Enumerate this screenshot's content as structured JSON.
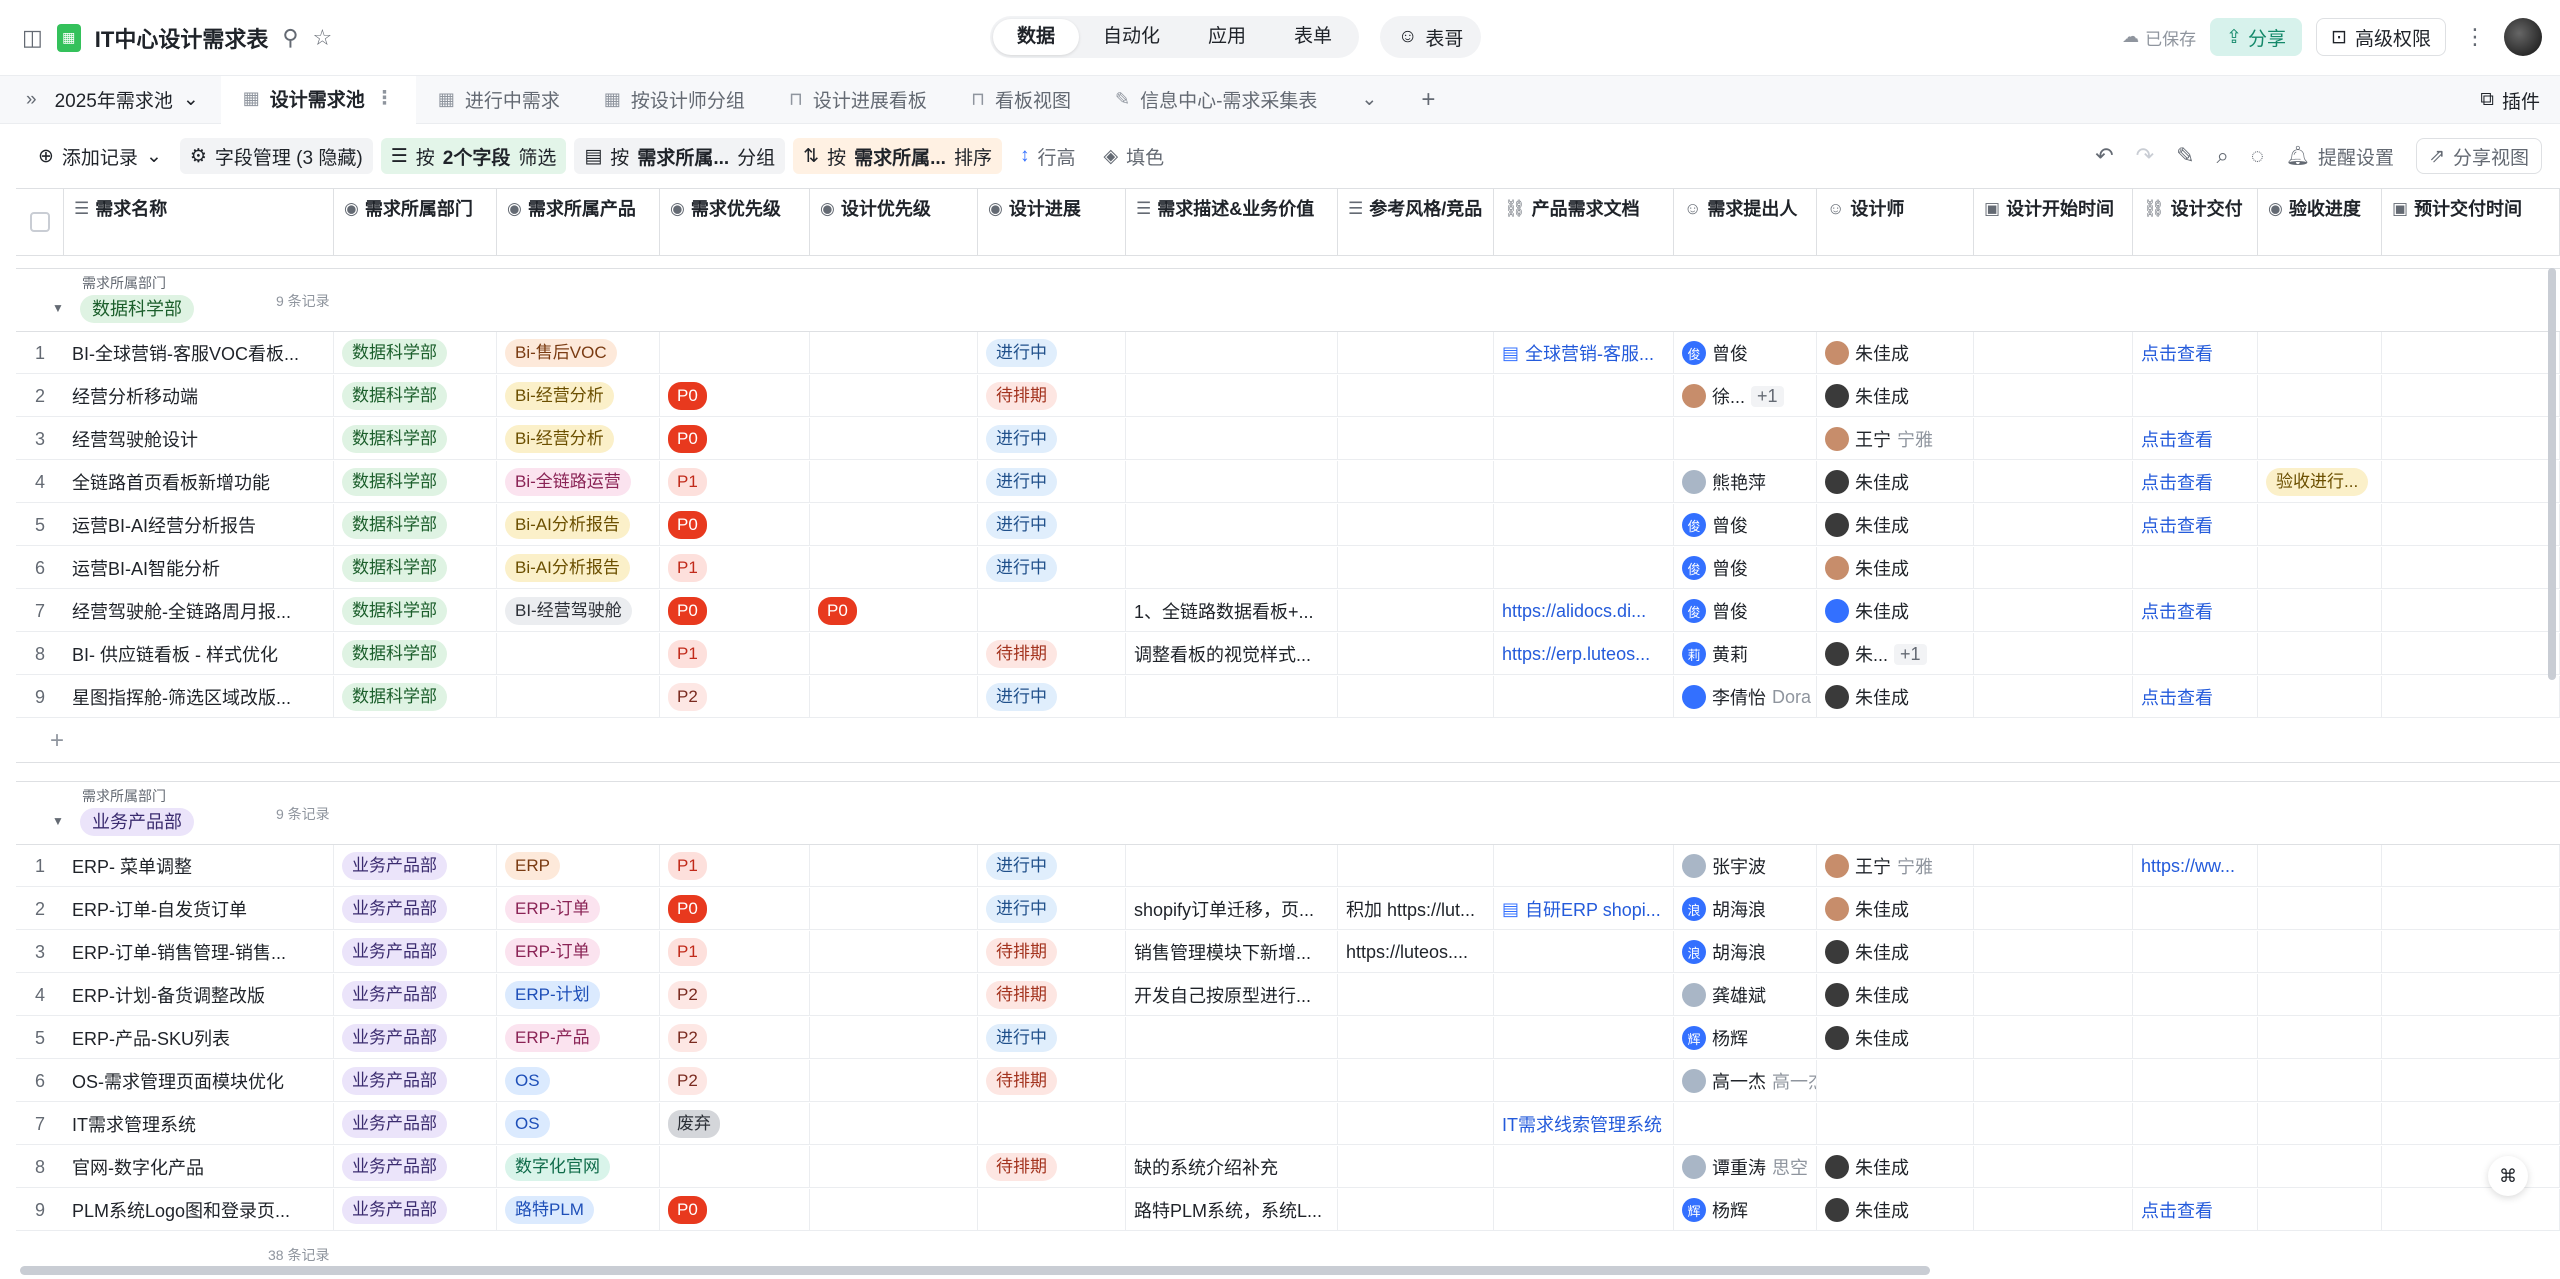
{
  "app": {
    "title": "IT中心设计需求表",
    "saved": "已保存",
    "share": "分享",
    "advanced": "高级权限"
  },
  "modes": [
    "数据",
    "自动化",
    "应用",
    "表单"
  ],
  "assistant": "表哥",
  "tabs": {
    "pool": "2025年需求池",
    "views": [
      "设计需求池",
      "进行中需求",
      "按设计师分组",
      "设计进展看板",
      "看板视图",
      "信息中心-需求采集表"
    ],
    "plugin": "插件"
  },
  "toolbar": {
    "add": "添加记录",
    "fields": "字段管理 (3 隐藏)",
    "filter_pre": "按",
    "filter_b": "2个字段",
    "filter_post": "筛选",
    "group_pre": "按",
    "group_b": "需求所属...",
    "group_post": "分组",
    "sort_pre": "按",
    "sort_b": "需求所属...",
    "sort_post": "排序",
    "rowheight": "行高",
    "fill": "填色",
    "remind": "提醒设置",
    "share_view": "分享视图"
  },
  "columns": [
    "需求名称",
    "需求所属部门",
    "需求所属产品",
    "需求优先级",
    "设计优先级",
    "设计进展",
    "需求描述&业务价值",
    "参考风格/竞品",
    "产品需求文档",
    "需求提出人",
    "设计师",
    "设计开始时间",
    "设计交付",
    "验收进度",
    "预计交付时间"
  ],
  "groups": [
    {
      "label": "需求所属部门",
      "name": "数据科学部",
      "count": "9 条记录",
      "rows": [
        {
          "n": "1",
          "name": "BI-全球营销-客服VOC看板...",
          "dept": "数据科学部",
          "prod": "Bi-售后VOC",
          "prod_c": "t-orange",
          "prio": "",
          "dprio": "",
          "prog": "进行中",
          "desc": "",
          "ref": "",
          "doc": "全球营销-客服...",
          "doc_icon": true,
          "req": "曾俊",
          "req_av": "俊",
          "req_c": "av-b",
          "req_extra": "",
          "designer": "朱佳成",
          "des_c": "av-p",
          "des_extra": "",
          "deliver": "点击查看",
          "acc": ""
        },
        {
          "n": "2",
          "name": "经营分析移动端",
          "dept": "数据科学部",
          "prod": "Bi-经营分析",
          "prod_c": "t-yellow",
          "prio": "P0",
          "dprio": "",
          "prog": "待排期",
          "desc": "",
          "ref": "",
          "doc": "",
          "req": "徐...",
          "req_av": "",
          "req_c": "av-p",
          "req_extra": "+1",
          "designer": "朱佳成",
          "des_c": "av-d",
          "des_extra": "",
          "deliver": "",
          "acc": ""
        },
        {
          "n": "3",
          "name": "经营驾驶舱设计",
          "dept": "数据科学部",
          "prod": "Bi-经营分析",
          "prod_c": "t-yellow",
          "prio": "P0",
          "dprio": "",
          "prog": "进行中",
          "desc": "",
          "ref": "",
          "doc": "",
          "req": "",
          "req_av": "",
          "req_c": "",
          "req_extra": "",
          "designer": "王宁",
          "des_c": "av-p",
          "des_extra": "宁雅",
          "deliver": "点击查看",
          "acc": ""
        },
        {
          "n": "4",
          "name": "全链路首页看板新增功能",
          "dept": "数据科学部",
          "prod": "Bi-全链路运营",
          "prod_c": "t-pink",
          "prio": "P1",
          "dprio": "",
          "prog": "进行中",
          "desc": "",
          "ref": "",
          "doc": "",
          "req": "熊艳萍",
          "req_av": "",
          "req_c": "av-l",
          "req_extra": "",
          "designer": "朱佳成",
          "des_c": "av-d",
          "des_extra": "",
          "deliver": "点击查看",
          "acc": "验收进行..."
        },
        {
          "n": "5",
          "name": "运营BI-AI经营分析报告",
          "dept": "数据科学部",
          "prod": "Bi-AI分析报告",
          "prod_c": "t-yellow",
          "prio": "P0",
          "dprio": "",
          "prog": "进行中",
          "desc": "",
          "ref": "",
          "doc": "",
          "req": "曾俊",
          "req_av": "俊",
          "req_c": "av-b",
          "req_extra": "",
          "designer": "朱佳成",
          "des_c": "av-d",
          "des_extra": "",
          "deliver": "点击查看",
          "acc": ""
        },
        {
          "n": "6",
          "name": "运营BI-AI智能分析",
          "dept": "数据科学部",
          "prod": "Bi-AI分析报告",
          "prod_c": "t-yellow",
          "prio": "P1",
          "dprio": "",
          "prog": "进行中",
          "desc": "",
          "ref": "",
          "doc": "",
          "req": "曾俊",
          "req_av": "俊",
          "req_c": "av-b",
          "req_extra": "",
          "designer": "朱佳成",
          "des_c": "av-p",
          "des_extra": "",
          "deliver": "",
          "acc": ""
        },
        {
          "n": "7",
          "name": "经营驾驶舱-全链路周月报...",
          "dept": "数据科学部",
          "prod": "BI-经营驾驶舱",
          "prod_c": "t-gray",
          "prio": "P0",
          "dprio": "P0",
          "prog": "",
          "desc": "1、全链路数据看板+...",
          "ref": "",
          "doc": "https://alidocs.di...",
          "req": "曾俊",
          "req_av": "俊",
          "req_c": "av-b",
          "req_extra": "",
          "designer": "朱佳成",
          "des_c": "av-b",
          "des_extra": "",
          "deliver": "点击查看",
          "acc": ""
        },
        {
          "n": "8",
          "name": "BI- 供应链看板 - 样式优化",
          "dept": "数据科学部",
          "prod": "",
          "prod_c": "",
          "prio": "P1",
          "dprio": "",
          "prog": "待排期",
          "desc": "调整看板的视觉样式...",
          "ref": "",
          "doc": "https://erp.luteos...",
          "req": "黄莉",
          "req_av": "莉",
          "req_c": "av-b",
          "req_extra": "",
          "designer": "朱...",
          "des_c": "av-d",
          "des_extra": "+1",
          "deliver": "",
          "acc": ""
        },
        {
          "n": "9",
          "name": "星图指挥舱-筛选区域改版...",
          "dept": "数据科学部",
          "prod": "",
          "prod_c": "",
          "prio": "P2",
          "dprio": "",
          "prog": "进行中",
          "desc": "",
          "ref": "",
          "doc": "",
          "req": "李倩怡",
          "req_av": "",
          "req_c": "av-b",
          "req_extra": "Dora",
          "designer": "朱佳成",
          "des_c": "av-d",
          "des_extra": "",
          "deliver": "点击查看",
          "acc": ""
        }
      ]
    },
    {
      "label": "需求所属部门",
      "name": "业务产品部",
      "count": "9 条记录",
      "rows": [
        {
          "n": "1",
          "name": "ERP- 菜单调整",
          "dept": "业务产品部",
          "prod": "ERP",
          "prod_c": "t-orange",
          "prio": "P1",
          "dprio": "",
          "prog": "进行中",
          "desc": "",
          "ref": "",
          "doc": "",
          "req": "张宇波",
          "req_av": "",
          "req_c": "av-l",
          "req_extra": "",
          "designer": "王宁",
          "des_c": "av-p",
          "des_extra": "宁雅",
          "deliver": "https://ww...",
          "acc": ""
        },
        {
          "n": "2",
          "name": "ERP-订单-自发货订单",
          "dept": "业务产品部",
          "prod": "ERP-订单",
          "prod_c": "t-pink",
          "prio": "P0",
          "dprio": "",
          "prog": "进行中",
          "desc": "shopify订单迁移，页...",
          "ref": "积加 https://lut...",
          "doc": "自研ERP shopi...",
          "doc_icon": true,
          "req": "胡海浪",
          "req_av": "浪",
          "req_c": "av-b",
          "req_extra": "",
          "designer": "朱佳成",
          "des_c": "av-p",
          "des_extra": "",
          "deliver": "",
          "acc": ""
        },
        {
          "n": "3",
          "name": "ERP-订单-销售管理-销售...",
          "dept": "业务产品部",
          "prod": "ERP-订单",
          "prod_c": "t-pink",
          "prio": "P1",
          "dprio": "",
          "prog": "待排期",
          "desc": "销售管理模块下新增...",
          "ref": "https://luteos....",
          "doc": "",
          "req": "胡海浪",
          "req_av": "浪",
          "req_c": "av-b",
          "req_extra": "",
          "designer": "朱佳成",
          "des_c": "av-d",
          "des_extra": "",
          "deliver": "",
          "acc": ""
        },
        {
          "n": "4",
          "name": "ERP-计划-备货调整改版",
          "dept": "业务产品部",
          "prod": "ERP-计划",
          "prod_c": "t-blue",
          "prio": "P2",
          "dprio": "",
          "prog": "待排期",
          "desc": "开发自己按原型进行...",
          "ref": "",
          "doc": "",
          "req": "龚雄斌",
          "req_av": "",
          "req_c": "av-l",
          "req_extra": "",
          "designer": "朱佳成",
          "des_c": "av-d",
          "des_extra": "",
          "deliver": "",
          "acc": ""
        },
        {
          "n": "5",
          "name": "ERP-产品-SKU列表",
          "dept": "业务产品部",
          "prod": "ERP-产品",
          "prod_c": "t-pink",
          "prio": "P2",
          "dprio": "",
          "prog": "进行中",
          "desc": "",
          "ref": "",
          "doc": "",
          "req": "杨辉",
          "req_av": "辉",
          "req_c": "av-b",
          "req_extra": "",
          "designer": "朱佳成",
          "des_c": "av-d",
          "des_extra": "",
          "deliver": "",
          "acc": ""
        },
        {
          "n": "6",
          "name": "OS-需求管理页面模块优化",
          "dept": "业务产品部",
          "prod": "OS",
          "prod_c": "t-blue",
          "prio": "P2",
          "dprio": "",
          "prog": "待排期",
          "desc": "",
          "ref": "",
          "doc": "",
          "req": "高一杰",
          "req_av": "",
          "req_c": "av-l",
          "req_extra": "高一杰",
          "designer": "",
          "des_c": "",
          "des_extra": "",
          "deliver": "",
          "acc": ""
        },
        {
          "n": "7",
          "name": "IT需求管理系统",
          "dept": "业务产品部",
          "prod": "OS",
          "prod_c": "t-blue",
          "prio": "废弃",
          "dprio": "",
          "prog": "",
          "desc": "",
          "ref": "",
          "doc": "IT需求线索管理系统",
          "req": "",
          "req_av": "",
          "req_c": "",
          "req_extra": "",
          "designer": "",
          "des_c": "",
          "des_extra": "",
          "deliver": "",
          "acc": ""
        },
        {
          "n": "8",
          "name": "官网-数字化产品",
          "dept": "业务产品部",
          "prod": "数字化官网",
          "prod_c": "t-mint",
          "prio": "",
          "dprio": "",
          "prog": "待排期",
          "desc": "缺的系统介绍补充",
          "ref": "",
          "doc": "",
          "req": "谭重涛",
          "req_av": "",
          "req_c": "av-l",
          "req_extra": "思空",
          "designer": "朱佳成",
          "des_c": "av-d",
          "des_extra": "",
          "deliver": "",
          "acc": ""
        },
        {
          "n": "9",
          "name": "PLM系统Logo图和登录页...",
          "dept": "业务产品部",
          "prod": "路特PLM",
          "prod_c": "t-blue",
          "prio": "P0",
          "dprio": "",
          "prog": "",
          "desc": "路特PLM系统，系统L...",
          "ref": "",
          "doc": "",
          "req": "杨辉",
          "req_av": "辉",
          "req_c": "av-b",
          "req_extra": "",
          "designer": "朱佳成",
          "des_c": "av-d",
          "des_extra": "",
          "deliver": "点击查看",
          "acc": ""
        }
      ]
    }
  ],
  "footer_count": "38 条记录",
  "colors": {
    "accent": "#245bdb",
    "brand": "#34c15b",
    "p0": "#e8391e"
  },
  "icons": [
    "sidebar-toggle-icon",
    "pin-icon",
    "star-icon",
    "robot-icon",
    "share-icon",
    "lock-icon",
    "more-icon",
    "expand-icon",
    "plus-icon",
    "undo-icon",
    "redo-icon",
    "edit-icon",
    "search-icon",
    "comment-icon",
    "bell-icon",
    "help-icon"
  ]
}
